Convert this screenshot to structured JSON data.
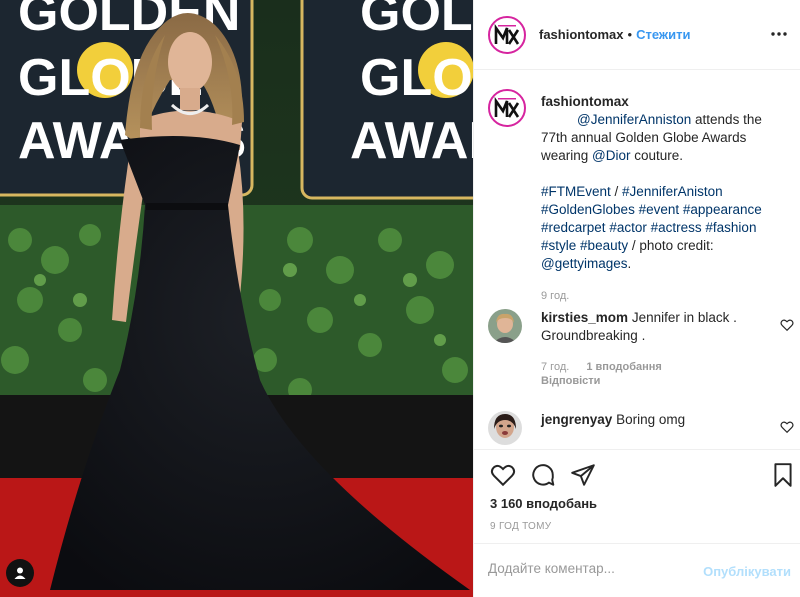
{
  "photo": {
    "sign_word_1": "GOLDEN",
    "sign_word_2": "GLOBE",
    "sign_word_3": "AWARDS",
    "carpet_color": "#c41a1a",
    "hedge_color": "#2d5a2a",
    "dress_color": "#121418",
    "sign_color": "#1c2630",
    "user_tag_icon": "user-icon"
  },
  "header": {
    "username": "fashiontomax",
    "separator": "•",
    "follow_label": "Стежити",
    "more_icon": "more-horizontal-icon"
  },
  "caption": {
    "username": "fashiontomax",
    "mention_actress": "@JenniferAnniston",
    "text_1": " attends the 77th annual Golden Globe Awards wearing ",
    "mention_brand": "@Dior",
    "text_2": " couture.",
    "tag_ftmevent": "#FTMEvent",
    "sep_slash": " / ",
    "tag_jenniferaniston": "#JenniferAniston",
    "tag_goldenglobes": "#GoldenGlobes",
    "tag_event": "#event",
    "tag_appearance": "#appearance",
    "tag_redcarpet": "#redcarpet",
    "tag_actor": "#actor",
    "tag_actress": "#actress",
    "tag_fashion": "#fashion",
    "tag_style": "#style",
    "tag_beauty": "#beauty",
    "credit_text": " / photo credit: ",
    "mention_getty": "@gettyimages",
    "credit_end": ".",
    "time": "9 год."
  },
  "comments": [
    {
      "username": "kirsties_mom",
      "text": "Jennifer in black . Groundbreaking .",
      "time": "7 год.",
      "likes": "1 вподобання",
      "reply": "Відповісти"
    },
    {
      "username": "jengrenyay",
      "text": "Boring omg"
    }
  ],
  "actions": {
    "like_icon": "heart-icon",
    "comment_icon": "comment-icon",
    "share_icon": "share-icon",
    "save_icon": "bookmark-icon",
    "likes_count": "3 160 вподобань",
    "posted_ago": "9 ГОД ТОМУ"
  },
  "add_comment": {
    "placeholder": "Додайте коментар...",
    "publish_label": "Опублікувати",
    "publish_color": "#b2dffc"
  }
}
